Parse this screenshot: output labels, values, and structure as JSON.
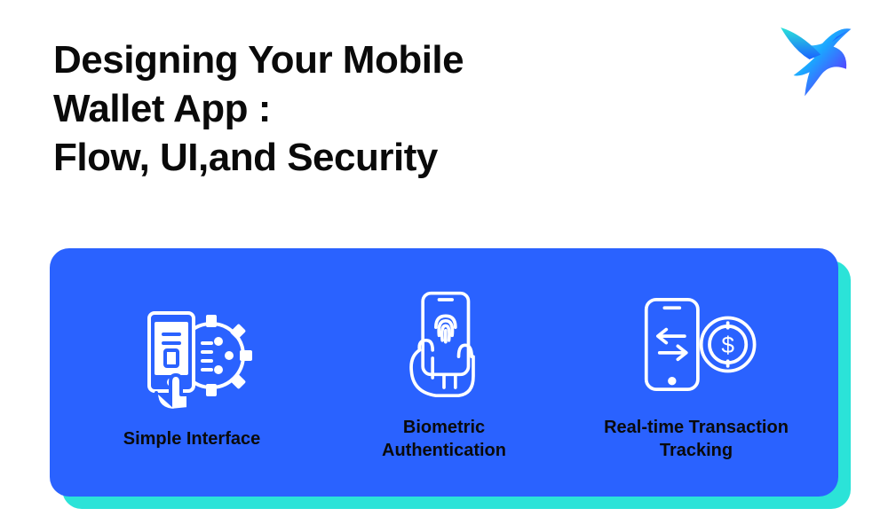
{
  "title_line1": "Designing Your Mobile",
  "title_line2": "Wallet App :",
  "title_line3": "Flow, UI,and Security",
  "card": {
    "accent_bg": "#2be3d8",
    "bg": "#2a62ff",
    "features": [
      {
        "icon": "simple-interface-icon",
        "label": "Simple Interface"
      },
      {
        "icon": "biometric-auth-icon",
        "label": "Biometric\nAuthentication"
      },
      {
        "icon": "transaction-track-icon",
        "label": "Real-time Transaction\nTracking"
      }
    ]
  },
  "brand": {
    "icon": "hummingbird-logo"
  }
}
